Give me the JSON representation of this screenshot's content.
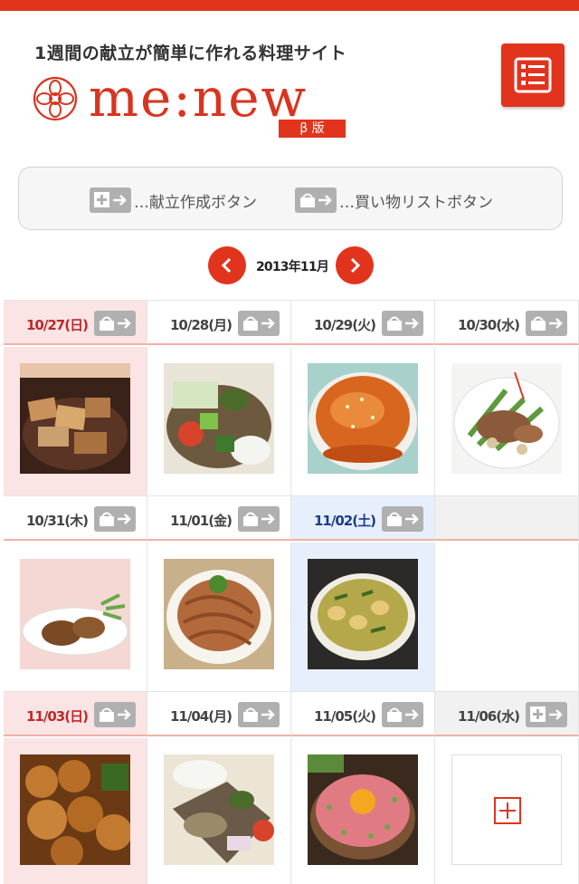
{
  "header": {
    "tagline": "1週間の献立が簡単に作れる料理サイト",
    "logo_text": "me:new",
    "logo_badge": "β 版"
  },
  "legend": {
    "create_label": "…献立作成ボタン",
    "shopping_label": "…買い物リストボタン"
  },
  "calendar": {
    "month_label": "2013年11月",
    "weeks": [
      [
        {
          "date": "10/27(日)",
          "type": "sun",
          "button": "basket",
          "photo": "tonkatsu-rice"
        },
        {
          "date": "10/28(月)",
          "type": "weekday",
          "button": "basket",
          "photo": "veggie-plate"
        },
        {
          "date": "10/29(火)",
          "type": "weekday",
          "button": "basket",
          "photo": "ankake-omelette"
        },
        {
          "date": "10/30(水)",
          "type": "weekday",
          "button": "basket",
          "photo": "stirfry-beef"
        }
      ],
      [
        {
          "date": "10/31(木)",
          "type": "weekday",
          "button": "basket",
          "photo": "grilled-fish"
        },
        {
          "date": "11/01(金)",
          "type": "weekday",
          "button": "basket",
          "photo": "spaghetti"
        },
        {
          "date": "11/02(土)",
          "type": "sat",
          "button": "basket",
          "photo": "curry"
        },
        {
          "date": "",
          "type": "empty",
          "button": "",
          "photo": ""
        }
      ],
      [
        {
          "date": "11/03(日)",
          "type": "sun",
          "button": "basket",
          "photo": "karaage"
        },
        {
          "date": "11/04(月)",
          "type": "weekday",
          "button": "basket",
          "photo": "bento"
        },
        {
          "date": "11/05(火)",
          "type": "weekday",
          "button": "basket",
          "photo": "tuna-donburi"
        },
        {
          "date": "11/06(水)",
          "type": "empty",
          "button": "plus",
          "photo": "add-placeholder"
        }
      ]
    ]
  },
  "colors": {
    "brand_red": "#e2341d",
    "sunday_bg": "#fbe4e4",
    "saturday_bg": "#e6effb",
    "button_gray": "#b0b0b0"
  },
  "icons": {
    "menu": "list-menu-icon",
    "prev": "chevron-left-icon",
    "next": "chevron-right-icon",
    "shopping": "basket-arrow-icon",
    "create": "plus-arrow-icon"
  }
}
